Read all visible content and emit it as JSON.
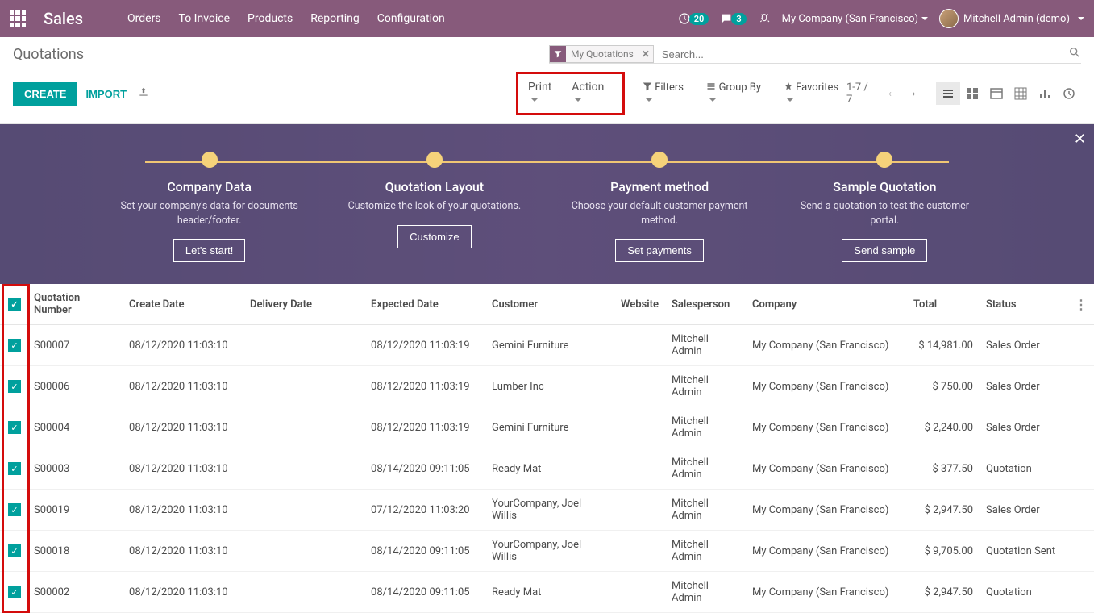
{
  "nav": {
    "brand": "Sales",
    "links": [
      "Orders",
      "To Invoice",
      "Products",
      "Reporting",
      "Configuration"
    ],
    "activities_badge": "20",
    "messages_badge": "3",
    "company": "My Company (San Francisco)",
    "user": "Mitchell Admin (demo)"
  },
  "breadcrumb": "Quotations",
  "search": {
    "facet_label": "My Quotations",
    "placeholder": "Search..."
  },
  "buttons": {
    "create": "CREATE",
    "import": "IMPORT",
    "print": "Print",
    "action": "Action",
    "filters": "Filters",
    "groupby": "Group By",
    "favorites": "Favorites"
  },
  "pager": "1-7 / 7",
  "banner": {
    "steps": [
      {
        "title": "Company Data",
        "desc": "Set your company's data for documents header/footer.",
        "btn": "Let's start!"
      },
      {
        "title": "Quotation Layout",
        "desc": "Customize the look of your quotations.",
        "btn": "Customize"
      },
      {
        "title": "Payment method",
        "desc": "Choose your default customer payment method.",
        "btn": "Set payments"
      },
      {
        "title": "Sample Quotation",
        "desc": "Send a quotation to test the customer portal.",
        "btn": "Send sample"
      }
    ]
  },
  "table": {
    "headers": {
      "num": "Quotation Number",
      "create": "Create Date",
      "delivery": "Delivery Date",
      "expected": "Expected Date",
      "customer": "Customer",
      "website": "Website",
      "salesperson": "Salesperson",
      "company": "Company",
      "total": "Total",
      "status": "Status"
    },
    "rows": [
      {
        "num": "S00007",
        "create": "08/12/2020 11:03:10",
        "delivery": "",
        "expected": "08/12/2020 11:03:19",
        "customer": "Gemini Furniture",
        "website": "",
        "salesperson": "Mitchell Admin",
        "company": "My Company (San Francisco)",
        "total": "$ 14,981.00",
        "status": "Sales Order"
      },
      {
        "num": "S00006",
        "create": "08/12/2020 11:03:10",
        "delivery": "",
        "expected": "08/12/2020 11:03:19",
        "customer": "Lumber Inc",
        "website": "",
        "salesperson": "Mitchell Admin",
        "company": "My Company (San Francisco)",
        "total": "$ 750.00",
        "status": "Sales Order"
      },
      {
        "num": "S00004",
        "create": "08/12/2020 11:03:10",
        "delivery": "",
        "expected": "08/12/2020 11:03:19",
        "customer": "Gemini Furniture",
        "website": "",
        "salesperson": "Mitchell Admin",
        "company": "My Company (San Francisco)",
        "total": "$ 2,240.00",
        "status": "Sales Order"
      },
      {
        "num": "S00003",
        "create": "08/12/2020 11:03:10",
        "delivery": "",
        "expected": "08/14/2020 09:11:05",
        "customer": "Ready Mat",
        "website": "",
        "salesperson": "Mitchell Admin",
        "company": "My Company (San Francisco)",
        "total": "$ 377.50",
        "status": "Quotation"
      },
      {
        "num": "S00019",
        "create": "08/12/2020 11:03:10",
        "delivery": "",
        "expected": "07/12/2020 11:03:20",
        "customer": "YourCompany, Joel Willis",
        "website": "",
        "salesperson": "Mitchell Admin",
        "company": "My Company (San Francisco)",
        "total": "$ 2,947.50",
        "status": "Sales Order"
      },
      {
        "num": "S00018",
        "create": "08/12/2020 11:03:10",
        "delivery": "",
        "expected": "08/14/2020 09:11:05",
        "customer": "YourCompany, Joel Willis",
        "website": "",
        "salesperson": "Mitchell Admin",
        "company": "My Company (San Francisco)",
        "total": "$ 9,705.00",
        "status": "Quotation Sent"
      },
      {
        "num": "S00002",
        "create": "08/12/2020 11:03:10",
        "delivery": "",
        "expected": "08/14/2020 09:11:05",
        "customer": "Ready Mat",
        "website": "",
        "salesperson": "Mitchell Admin",
        "company": "My Company (San Francisco)",
        "total": "$ 2,947.50",
        "status": "Quotation"
      }
    ]
  }
}
